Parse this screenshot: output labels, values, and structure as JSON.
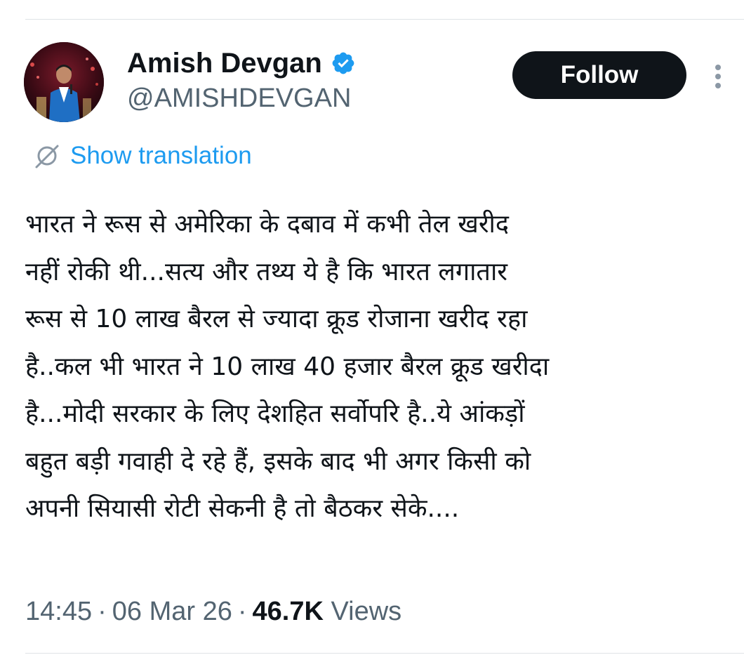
{
  "author": {
    "name": "Amish Devgan",
    "handle": "@AMISHDEVGAN",
    "verified": true,
    "avatar_icon": "profile-photo"
  },
  "actions": {
    "follow_label": "Follow",
    "more_icon": "more-vertical-icon"
  },
  "translation": {
    "label": "Show translation",
    "icon": "translate-icon"
  },
  "tweet": {
    "lines": [
      "भारत ने रूस से अमेरिका के दबाव में कभी तेल खरीद",
      "नहीं रोकी थी...सत्य और तथ्य ये है कि भारत लगातार",
      "रूस से 10 लाख बैरल से ज्यादा क्रूड रोजाना खरीद रहा",
      "है..कल भी भारत ने 10 लाख 40 हजार बैरल क्रूड खरीदा",
      "है...मोदी सरकार के लिए देशहित सर्वोपरि है..ये आंकड़ों",
      "बहुत बड़ी गवाही दे रहे हैं, इसके बाद भी अगर किसी को",
      "अपनी सियासी रोटी सेकनी है तो बैठकर सेके...."
    ]
  },
  "meta": {
    "time": "14:45",
    "date": "06 Mar 26",
    "views_count": "46.7K",
    "views_label": "Views",
    "separator": "·"
  },
  "colors": {
    "text": "#0f1419",
    "secondary": "#536471",
    "link": "#1d9bf0",
    "verified": "#1d9bf0",
    "follow_bg": "#0f1419"
  }
}
